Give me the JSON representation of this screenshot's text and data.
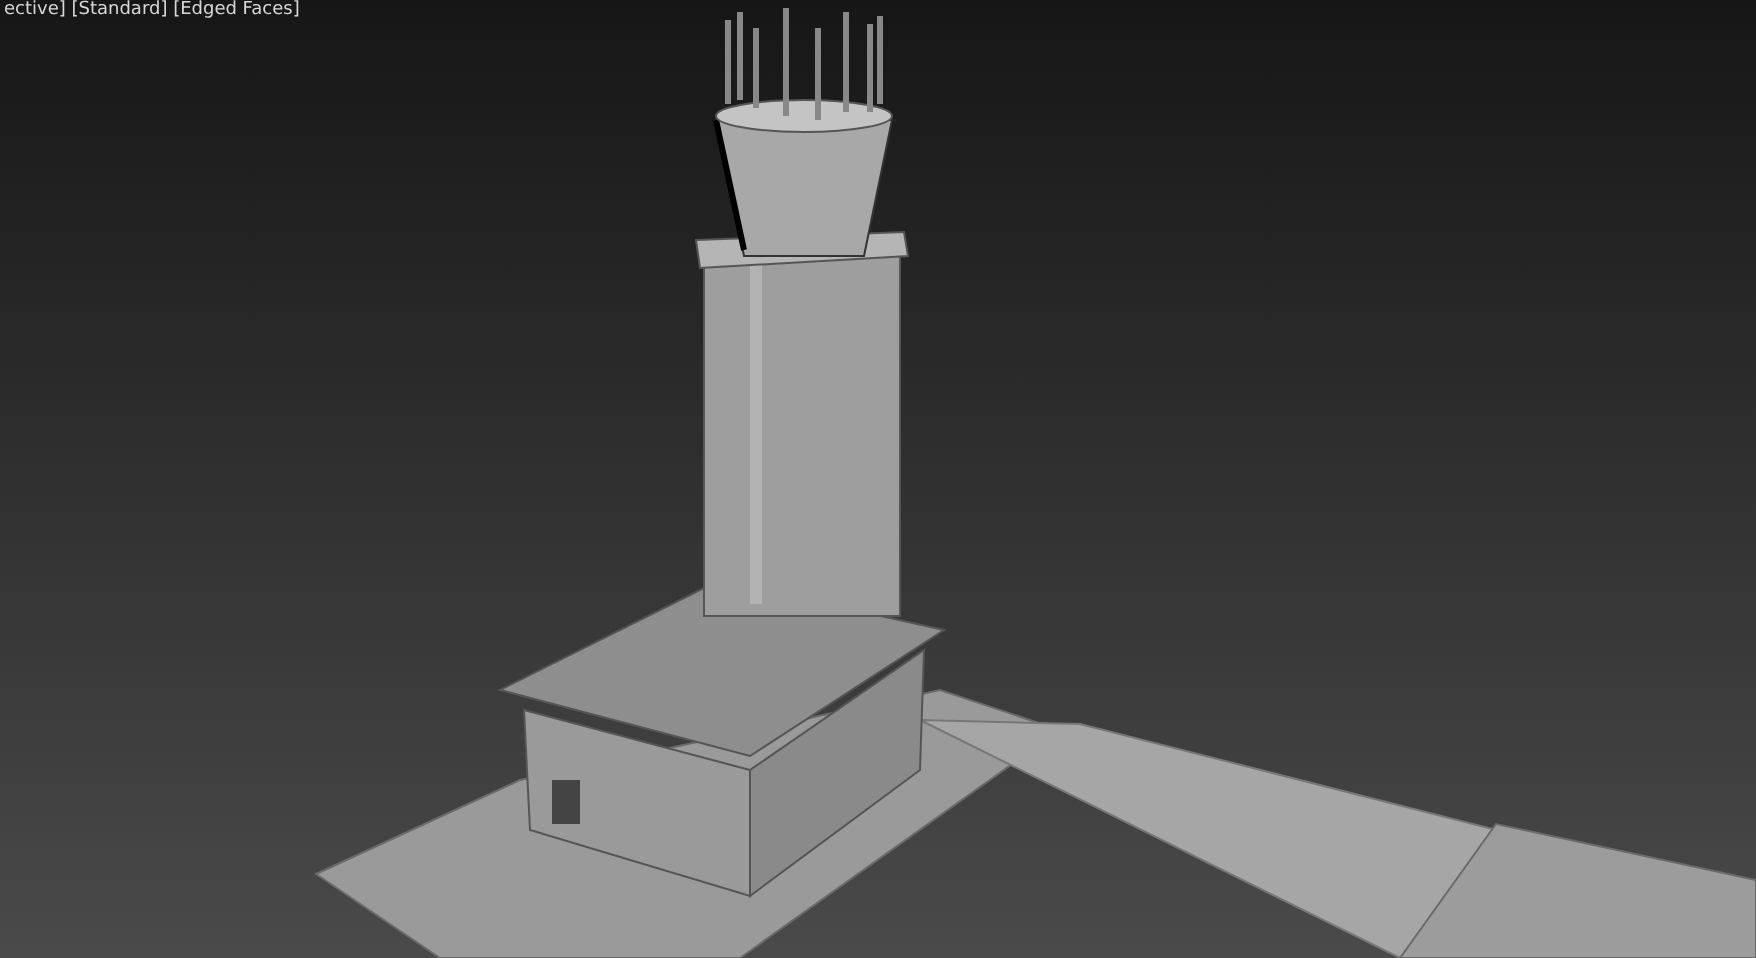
{
  "viewport": {
    "label": "ective] [Standard] [Edged Faces]"
  }
}
